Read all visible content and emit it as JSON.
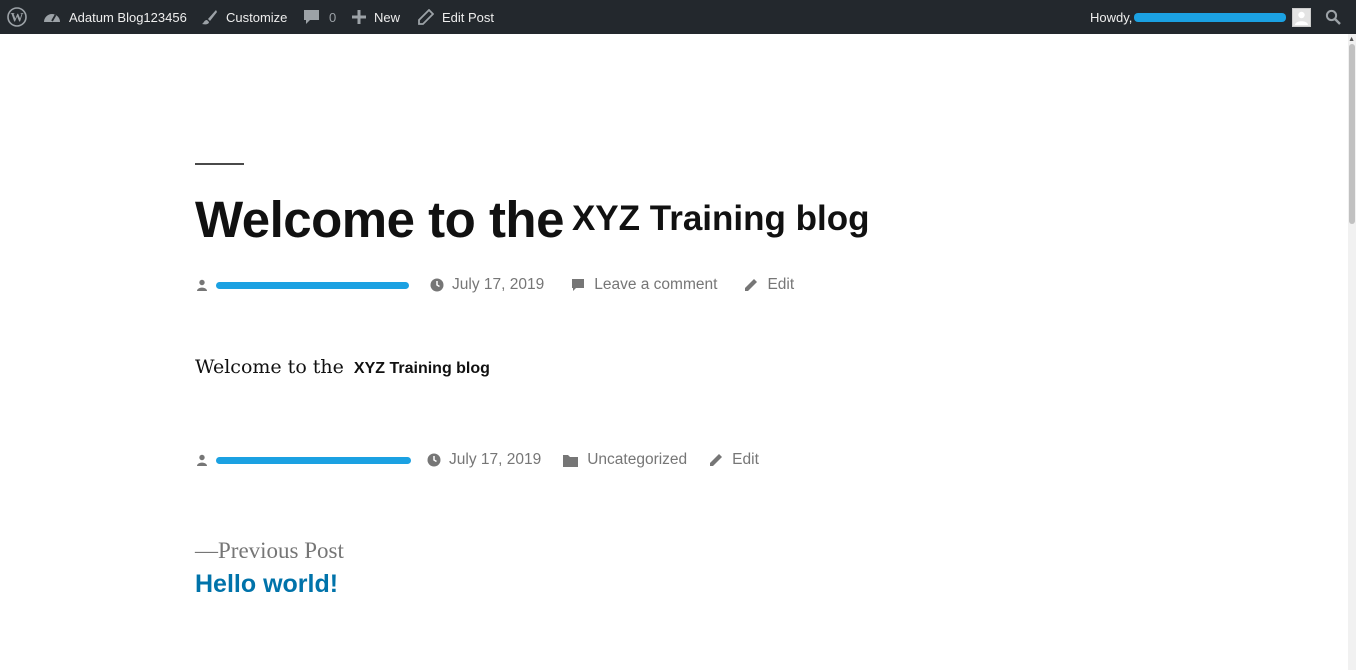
{
  "adminbar": {
    "wp_logo_icon": "wordpress-icon",
    "site_name": "Adatum Blog123456",
    "customize": "Customize",
    "comments_count": "0",
    "new": "New",
    "edit_post": "Edit Post",
    "howdy": "Howdy,",
    "bg_color": "#23282d"
  },
  "post": {
    "title_part1": "Welcome to the",
    "title_part2": "XYZ Training blog",
    "meta": {
      "date": "July 17, 2019",
      "comment": "Leave a comment",
      "edit": "Edit"
    },
    "body_serif": "Welcome to the",
    "body_sans": "XYZ Training blog",
    "footer_meta": {
      "date": "July 17, 2019",
      "category": "Uncategorized",
      "edit": "Edit"
    }
  },
  "nav": {
    "previous_label": "—Previous Post",
    "previous_title": "Hello world!",
    "link_color": "#0073aa"
  },
  "redaction_color": "#1ba1e2"
}
